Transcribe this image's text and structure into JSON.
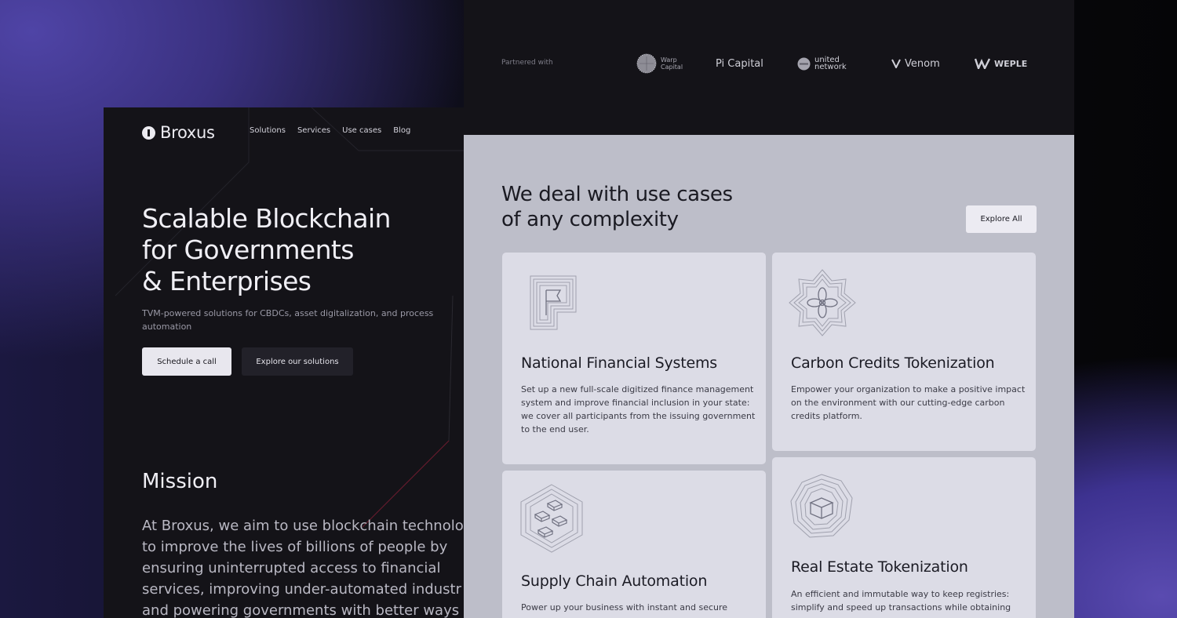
{
  "left_page": {
    "brand": "Broxus",
    "nav": [
      "Solutions",
      "Services",
      "Use cases",
      "Blog"
    ],
    "hero_title": "Scalable Blockchain\nfor Governments\n& Enterprises",
    "hero_subtitle": "TVM-powered solutions for CBDCs, asset digitalization, and process automation",
    "primary_button": "Schedule a call",
    "secondary_button": "Explore our solutions",
    "mission_title": "Mission",
    "mission_lines": [
      "At Broxus, we aim to use blockchain technolo",
      "to improve the lives of billions of people by",
      "ensuring uninterrupted access to financial",
      "services, improving under-automated industr",
      "and powering governments with better ways"
    ]
  },
  "partners": {
    "label": "Partnered with",
    "items": [
      {
        "name": "Warp",
        "sub": "Capital",
        "icon": "warp-capital-logo"
      },
      {
        "name": "Pi Capital",
        "icon": "pi-capital-logo"
      },
      {
        "name": "united",
        "sub": "network",
        "icon": "united-network-logo"
      },
      {
        "name": "Venom",
        "icon": "venom-logo"
      },
      {
        "name": "WEPLE",
        "icon": "weple-logo"
      }
    ]
  },
  "use_cases": {
    "title": "We deal with use cases\nof any complexity",
    "explore_button": "Explore All",
    "cards": [
      {
        "title": "National Financial Systems",
        "icon": "flag-icon",
        "desc": "Set up a new full-scale digitized finance management system and improve financial inclusion in your state: we cover all participants from the issuing government to the end user."
      },
      {
        "title": "Carbon Credits Tokenization",
        "icon": "flower-icon",
        "desc": "Empower your organization to make a positive impact on the environment with our cutting-edge carbon credits platform."
      },
      {
        "title": "Supply Chain Automation",
        "icon": "blocks-icon",
        "desc": "Power up your business with instant and secure"
      },
      {
        "title": "Real Estate Tokenization",
        "icon": "cube-icon",
        "desc": "An efficient and immutable way to keep registries: simplify and speed up transactions while obtaining"
      }
    ]
  }
}
